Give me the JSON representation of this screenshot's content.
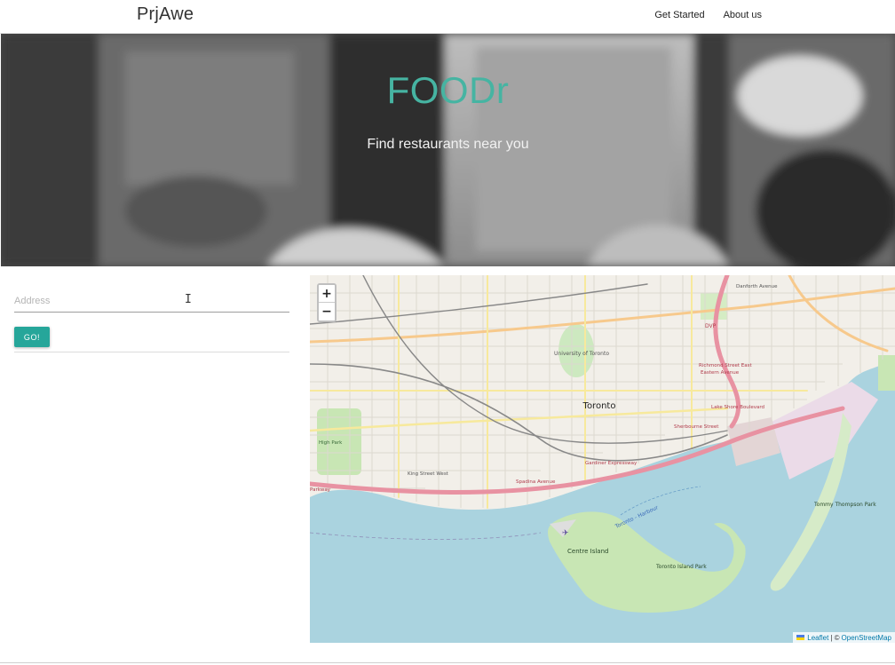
{
  "navbar": {
    "brand": "PrjAwe",
    "links": [
      {
        "label": "Get Started"
      },
      {
        "label": "About us"
      }
    ]
  },
  "hero": {
    "title": "FOODr",
    "subtitle": "Find restaurants near you",
    "title_color": "#46b4a2"
  },
  "form": {
    "address_placeholder": "Address",
    "address_value": "",
    "go_label": "GO!",
    "accent_color": "#26a69a"
  },
  "map": {
    "zoom_in": "+",
    "zoom_out": "−",
    "attribution_leaflet": "Leaflet",
    "attribution_separator": "| ©",
    "attribution_osm": "OpenStreetMap",
    "labels": {
      "city": "Toronto",
      "university": "University of Toronto",
      "dvp": "DVP",
      "richmond": "Richmond Street East",
      "adelaide": "Eastern Avenue",
      "lakeshore": "Lake Shore Boulevard",
      "sherbourne": "Sherbourne Street",
      "spadina": "Spadina Avenue",
      "gardiner": "Gardiner Expressway",
      "kingwest": "King Street West",
      "highpark": "High Park",
      "parkway": "Parkway",
      "centre_island": "Centre Island",
      "toronto_island_park": "Toronto Island Park",
      "tommy_thompson": "Tommy Thompson Park",
      "harbour": "Toronto - Harbour",
      "danforth": "Danforth Avenue"
    }
  }
}
